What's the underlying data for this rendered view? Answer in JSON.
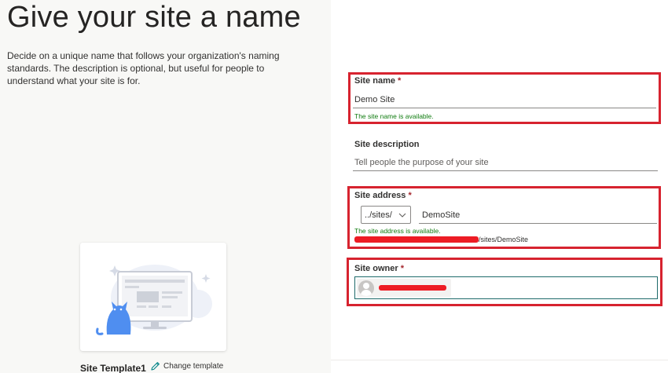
{
  "left": {
    "title": "Give your site a name",
    "description": "Decide on a unique name that follows your organization's naming standards. The description is optional, but useful for people to understand what your site is for.",
    "template": {
      "name": "Site Template1",
      "change_label": "Change template",
      "preview_icon": "monitor-cat-illustration"
    }
  },
  "form": {
    "site_name": {
      "label": "Site name",
      "required_mark": "*",
      "value": "Demo Site",
      "status": "The site name is available."
    },
    "site_description": {
      "label": "Site description",
      "placeholder": "Tell people the purpose of your site",
      "value": ""
    },
    "site_address": {
      "label": "Site address",
      "required_mark": "*",
      "prefix": "../sites/",
      "value": "DemoSite",
      "status": "The site address is available.",
      "url_suffix": "/sites/DemoSite"
    },
    "site_owner": {
      "label": "Site owner",
      "required_mark": "*",
      "avatar_icon": "person-avatar-icon"
    }
  },
  "colors": {
    "highlight": "#d7232f",
    "success": "#107c10",
    "required": "#a4262c",
    "redaction": "#ed1c24",
    "accent": "#1e6b6b"
  }
}
